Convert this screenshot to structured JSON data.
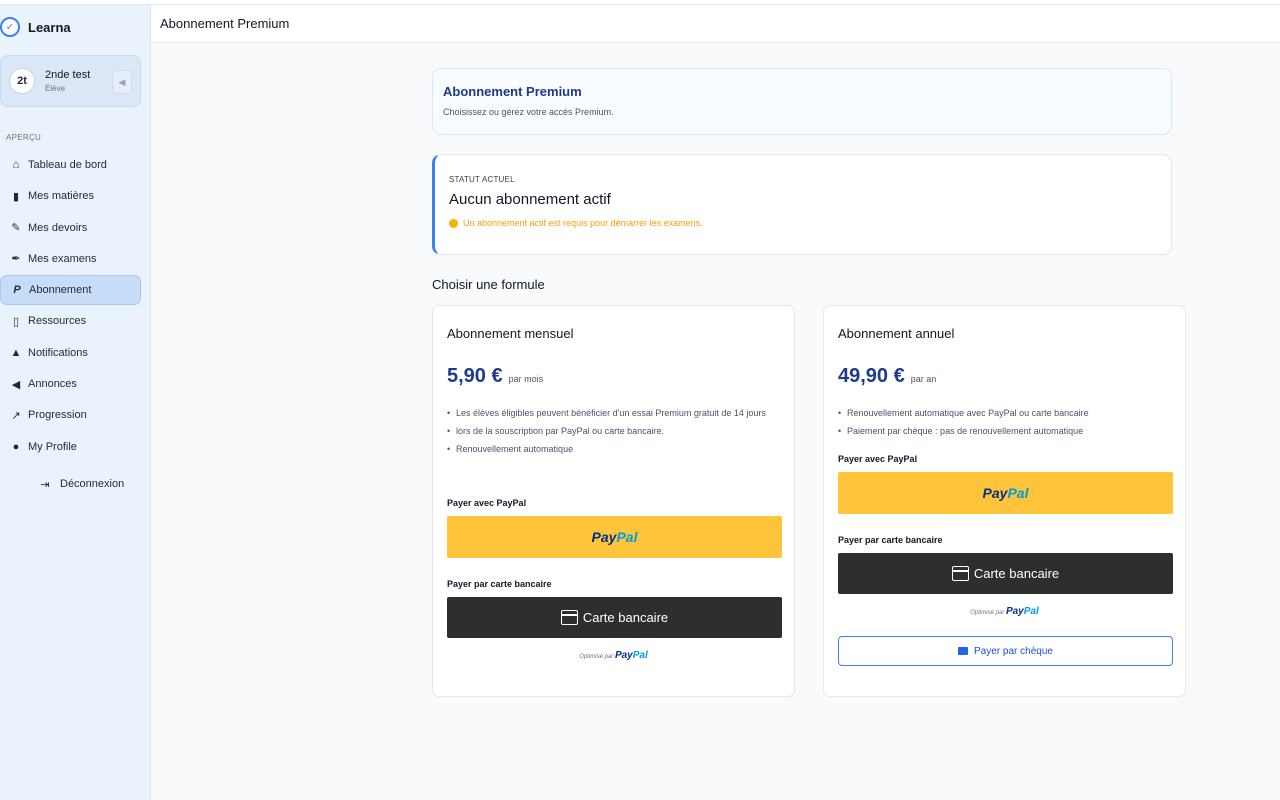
{
  "app": {
    "name": "Learna"
  },
  "user": {
    "initials": "2t",
    "name": "2nde test",
    "role": "Élève"
  },
  "sidebar": {
    "section_label": "APERÇU",
    "items": [
      {
        "label": "Tableau de bord",
        "icon": "home-icon"
      },
      {
        "label": "Mes matières",
        "icon": "book-icon"
      },
      {
        "label": "Mes devoirs",
        "icon": "pencil-icon"
      },
      {
        "label": "Mes examens",
        "icon": "pen-icon"
      },
      {
        "label": "Abonnement",
        "icon": "paypal-icon",
        "active": true
      },
      {
        "label": "Ressources",
        "icon": "folder-icon"
      },
      {
        "label": "Notifications",
        "icon": "bell-icon"
      },
      {
        "label": "Annonces",
        "icon": "megaphone-icon"
      },
      {
        "label": "Progression",
        "icon": "chart-icon"
      },
      {
        "label": "My Profile",
        "icon": "user-icon"
      }
    ],
    "logout_label": "Déconnexion"
  },
  "header": {
    "title": "Abonnement Premium"
  },
  "page": {
    "title": "Abonnement Premium",
    "subtitle": "Choisissez ou gérez votre accès Premium."
  },
  "status": {
    "label": "STATUT ACTUEL",
    "value": "Aucun abonnement actif",
    "warning": "Un abonnement actif est requis pour démarrer les examens."
  },
  "plans_title": "Choisir une formule",
  "plans": {
    "monthly": {
      "name": "Abonnement mensuel",
      "price": "5,90 €",
      "period": "par mois",
      "features": [
        "Les élèves éligibles peuvent bénéficier d'un essai Premium gratuit de 14 jours",
        "lors de la souscription par PayPal ou carte bancaire.",
        "Renouvellement automatique"
      ],
      "pay_paypal_label": "Payer avec PayPal",
      "pay_card_label": "Payer par carte bancaire",
      "card_button": "Carte bancaire",
      "powered_by": "Optimisé par"
    },
    "annual": {
      "name": "Abonnement annuel",
      "price": "49,90 €",
      "period": "par an",
      "features": [
        "Renouvellement automatique avec PayPal ou carte bancaire",
        "Paiement par chèque : pas de renouvellement automatique"
      ],
      "pay_paypal_label": "Payer avec PayPal",
      "pay_card_label": "Payer par carte bancaire",
      "card_button": "Carte bancaire",
      "powered_by": "Optimisé par",
      "cheque_button": "Payer par chèque"
    }
  },
  "paypal": {
    "part1": "Pay",
    "part2": "Pal"
  },
  "colors": {
    "accent": "#3b82f6",
    "paypal_yellow": "#ffc439",
    "card_black": "#2c2e2f",
    "warning": "#f59e0b",
    "title_blue": "#1e3a8a"
  }
}
